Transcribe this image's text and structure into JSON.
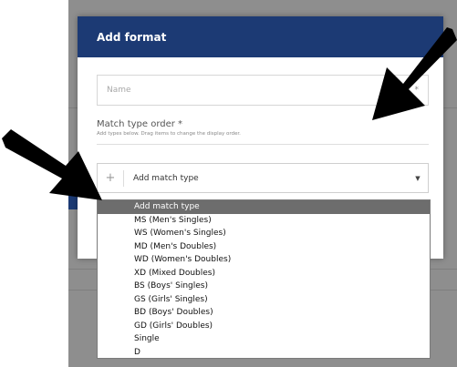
{
  "modal": {
    "title": "Add format",
    "name_placeholder": "Name",
    "name_required_mark": "*",
    "match_type_label": "Match type order *",
    "match_type_hint": "Add types below. Drag items to change the display order.",
    "select_plus": "+",
    "select_value": "Add match type",
    "select_caret": "▼"
  },
  "dropdown": {
    "options": [
      "Add match type",
      "MS (Men's Singles)",
      "WS (Women's Singles)",
      "MD (Men's Doubles)",
      "WD (Women's Doubles)",
      "XD (Mixed Doubles)",
      "BS (Boys' Singles)",
      "GS (Girls' Singles)",
      "BD (Boys' Doubles)",
      "GD (Girls' Doubles)",
      "Single",
      "D"
    ],
    "selected_index": 0
  },
  "colors": {
    "header": "#1c3a74",
    "backdrop": "#8e8e8e",
    "highlight": "#6d6d6d"
  }
}
